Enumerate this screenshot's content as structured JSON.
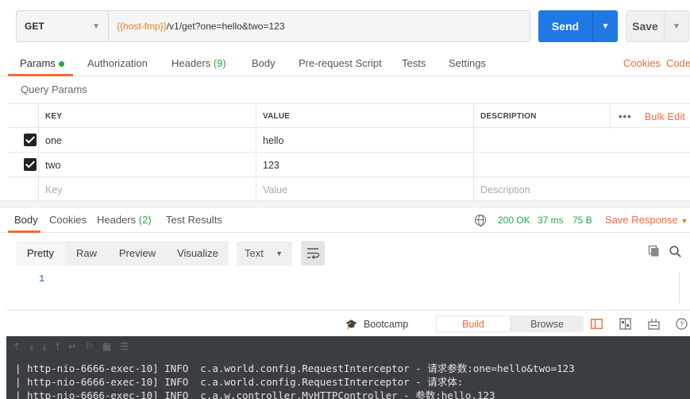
{
  "request": {
    "method": "GET",
    "url_var": "{{host-fmp}}",
    "url_rest": "/v1/get?one=hello&two=123",
    "send_label": "Send",
    "save_label": "Save"
  },
  "request_tabs": {
    "params": "Params",
    "authorization": "Authorization",
    "headers": "Headers",
    "headers_count": "(9)",
    "body": "Body",
    "prerequest": "Pre-request Script",
    "tests": "Tests",
    "settings": "Settings",
    "cookies": "Cookies",
    "code": "Code"
  },
  "query_params": {
    "title": "Query Params",
    "columns": {
      "key": "KEY",
      "value": "VALUE",
      "description": "DESCRIPTION",
      "bulk_edit": "Bulk Edit"
    },
    "rows": [
      {
        "key": "one",
        "value": "hello",
        "description": "",
        "checked": true
      },
      {
        "key": "two",
        "value": "123",
        "description": "",
        "checked": true
      }
    ],
    "placeholder": {
      "key": "Key",
      "value": "Value",
      "description": "Description"
    }
  },
  "response_tabs": {
    "body": "Body",
    "cookies": "Cookies",
    "headers": "Headers",
    "headers_count": "(2)",
    "test_results": "Test Results",
    "status": "200 OK",
    "time": "37 ms",
    "size": "75 B",
    "save_response": "Save Response"
  },
  "format": {
    "options": [
      "Pretty",
      "Raw",
      "Preview",
      "Visualize"
    ],
    "active": "Pretty",
    "type": "Text"
  },
  "editor": {
    "line_number": "1"
  },
  "status_bar": {
    "bootcamp": "Bootcamp",
    "build": "Build",
    "browse": "Browse"
  },
  "console": {
    "lines": [
      "| http-nio-6666-exec-10] INFO  c.a.world.config.RequestInterceptor - 请求参数:one=hello&two=123",
      "| http-nio-6666-exec-10] INFO  c.a.world.config.RequestInterceptor - 请求体:",
      "| http-nio-6666-exec-10] INFO  c.a.w.controller.MyHTTPController - 参数:hello,123"
    ]
  },
  "colors": {
    "accent": "#f26b3a",
    "send": "#1f79e5",
    "success": "#28a745",
    "url_var": "#e8812d"
  }
}
